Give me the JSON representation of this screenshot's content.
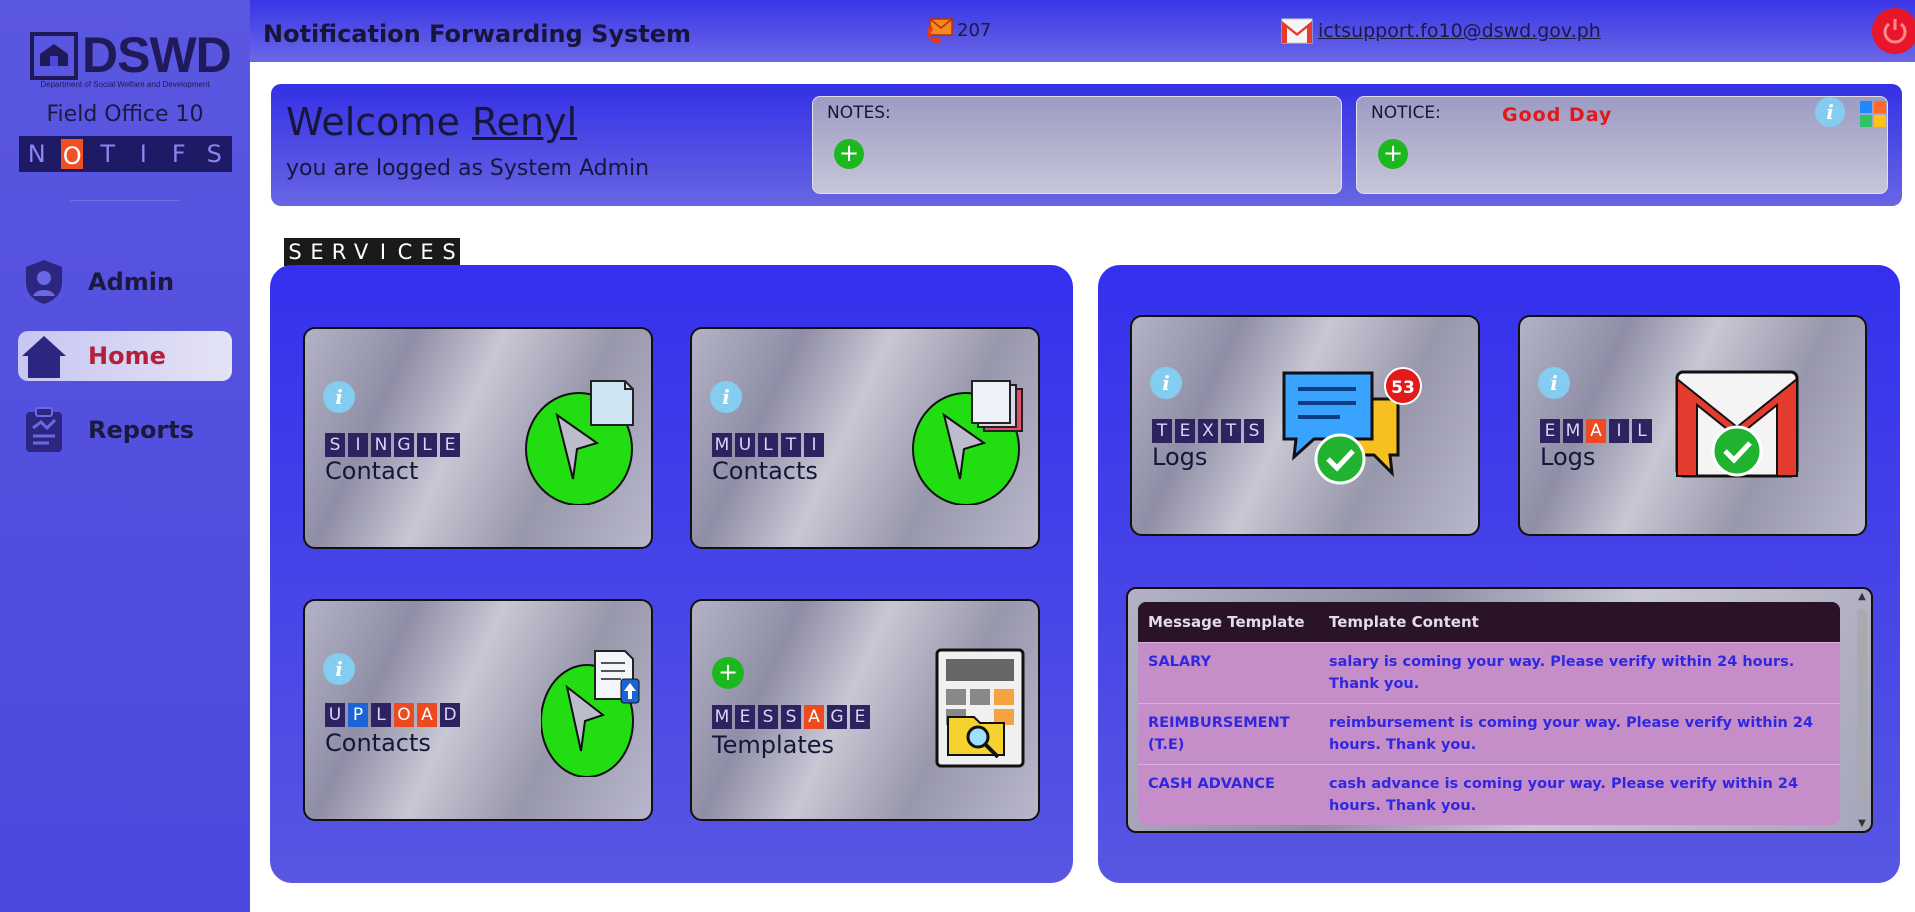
{
  "sidebar": {
    "logo_text": "DSWD",
    "logo_sub": "Department of Social Welfare and Development",
    "field_office": "Field Office 10",
    "notifs_letters": [
      "N",
      "O",
      "T",
      "I",
      "F",
      "S"
    ],
    "nav": [
      {
        "label": "Admin",
        "icon": "user-shield-icon"
      },
      {
        "label": "Home",
        "icon": "home-icon"
      },
      {
        "label": "Reports",
        "icon": "clipboard-chart-icon"
      }
    ]
  },
  "header": {
    "title": "Notification Forwarding System",
    "sms_count": "207",
    "email": "ictsupport.fo10@dswd.gov.ph"
  },
  "welcome": {
    "greeting": "Welcome",
    "username": "Renyl",
    "role_text": "you are logged as System Admin",
    "notes_label": "NOTES:",
    "notice_label": "NOTICE:",
    "notice_text": "Good  Day"
  },
  "services": {
    "label_letters": [
      "S",
      "E",
      "R",
      "V",
      "I",
      "C",
      "E",
      "S"
    ],
    "cards": [
      {
        "tiles": [
          "S",
          "I",
          "N",
          "G",
          "L",
          "E"
        ],
        "title": "Contact"
      },
      {
        "tiles": [
          "M",
          "U",
          "L",
          "T",
          "I"
        ],
        "title": "Contacts"
      },
      {
        "tiles": [
          "U",
          "P",
          "L",
          "O",
          "A",
          "D"
        ],
        "title": "Contacts"
      },
      {
        "tiles": [
          "M",
          "E",
          "S",
          "S",
          "A",
          "G",
          "E"
        ],
        "title": "Templates"
      }
    ]
  },
  "logs": {
    "texts": {
      "tiles": [
        "T",
        "E",
        "X",
        "T",
        "S"
      ],
      "title": "Logs",
      "badge": "53"
    },
    "email": {
      "tiles": [
        "E",
        "M",
        "A",
        "I",
        "L"
      ],
      "title": "Logs"
    }
  },
  "templates": {
    "headers": [
      "Message Template",
      "Template Content"
    ],
    "rows": [
      {
        "name": "SALARY",
        "content": "salary is coming your way. Please verify within 24 hours. Thank you."
      },
      {
        "name": "REIMBURSEMENT (T.E)",
        "content": "reimbursement is coming your way. Please verify within 24 hours. Thank you."
      },
      {
        "name": "CASH ADVANCE",
        "content": "cash advance is coming your way. Please verify within 24 hours. Thank you."
      }
    ]
  },
  "colors": {
    "accent": "#4b48de",
    "panel": "#3430ee",
    "green": "#22dd11",
    "red": "#e8162a"
  }
}
